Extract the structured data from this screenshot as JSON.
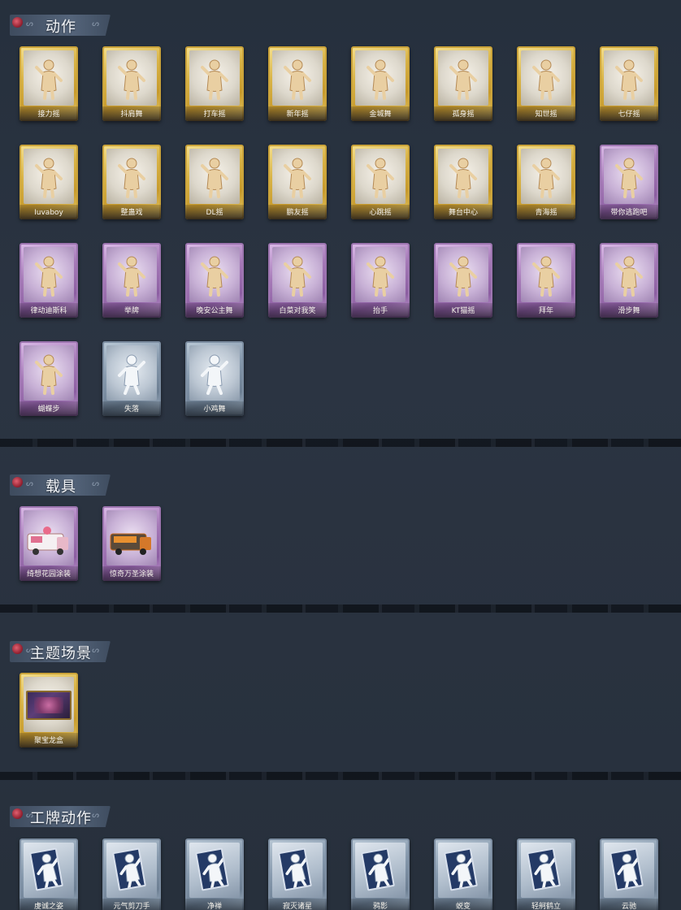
{
  "sections": {
    "actions": {
      "title": "动作",
      "items": [
        {
          "label": "接力摇",
          "tier": "gold",
          "icon": "figure-dance-icon"
        },
        {
          "label": "抖肩舞",
          "tier": "gold",
          "icon": "figure-dance-icon"
        },
        {
          "label": "打车摇",
          "tier": "gold",
          "icon": "figure-dance-icon"
        },
        {
          "label": "新年摇",
          "tier": "gold",
          "icon": "figure-dance-icon"
        },
        {
          "label": "金城舞",
          "tier": "gold",
          "icon": "figure-dance-icon"
        },
        {
          "label": "孤身摇",
          "tier": "gold",
          "icon": "figure-dance-icon"
        },
        {
          "label": "知世摇",
          "tier": "gold",
          "icon": "figure-dance-icon"
        },
        {
          "label": "七仔摇",
          "tier": "gold",
          "icon": "figure-dance-icon"
        },
        {
          "label": "Iuvaboy",
          "tier": "gold",
          "icon": "figure-dance-icon"
        },
        {
          "label": "整蛊戏",
          "tier": "gold",
          "icon": "figure-dance-icon"
        },
        {
          "label": "DL摇",
          "tier": "gold",
          "icon": "figure-dance-icon"
        },
        {
          "label": "鹏友摇",
          "tier": "gold",
          "icon": "figure-dance-icon"
        },
        {
          "label": "心跳摇",
          "tier": "gold",
          "icon": "figure-dance-icon"
        },
        {
          "label": "舞台中心",
          "tier": "gold",
          "icon": "figure-dance-icon"
        },
        {
          "label": "青海摇",
          "tier": "gold",
          "icon": "figure-dance-icon"
        },
        {
          "label": "带你逃跑吧",
          "tier": "purple",
          "icon": "figure-dance-icon"
        },
        {
          "label": "律动迪斯科",
          "tier": "purple",
          "icon": "figure-dance-icon"
        },
        {
          "label": "举牌",
          "tier": "purple",
          "icon": "figure-sign-icon"
        },
        {
          "label": "晚安公主舞",
          "tier": "purple",
          "icon": "figure-dance-icon"
        },
        {
          "label": "白菜对我笑",
          "tier": "purple",
          "icon": "figure-dance-icon"
        },
        {
          "label": "抬手",
          "tier": "purple",
          "icon": "figure-dance-icon"
        },
        {
          "label": "KT猫摇",
          "tier": "purple",
          "icon": "figure-dance-icon"
        },
        {
          "label": "拜年",
          "tier": "purple",
          "icon": "figure-dance-icon"
        },
        {
          "label": "滑步舞",
          "tier": "purple",
          "icon": "figure-dance-icon"
        },
        {
          "label": "蝴蝶步",
          "tier": "purple",
          "icon": "figure-dance-icon"
        },
        {
          "label": "失落",
          "tier": "blue",
          "icon": "figure-crawl-icon"
        },
        {
          "label": "小鸡舞",
          "tier": "blue",
          "icon": "figure-dance-icon"
        }
      ]
    },
    "vehicles": {
      "title": "载具",
      "items": [
        {
          "label": "绮想花园涂装",
          "tier": "purple",
          "icon": "ice-cream-truck-icon"
        },
        {
          "label": "惊奇万圣涂装",
          "tier": "purple",
          "icon": "halloween-truck-icon"
        }
      ]
    },
    "scenes": {
      "title": "主题场景",
      "items": [
        {
          "label": "聚宝龙盒",
          "tier": "gold",
          "icon": "scene-frame-icon"
        }
      ]
    },
    "tag_actions": {
      "title": "工牌动作",
      "items": [
        {
          "label": "虔诚之姿",
          "tier": "blue",
          "icon": "tag-card-icon"
        },
        {
          "label": "元气剪刀手",
          "tier": "blue",
          "icon": "tag-card-icon"
        },
        {
          "label": "净禅",
          "tier": "blue",
          "icon": "tag-card-icon"
        },
        {
          "label": "寂灭诸星",
          "tier": "blue",
          "icon": "tag-card-icon"
        },
        {
          "label": "鸦影",
          "tier": "blue",
          "icon": "tag-card-icon"
        },
        {
          "label": "蜕变",
          "tier": "blue",
          "icon": "tag-card-icon"
        },
        {
          "label": "轻舸鹤立",
          "tier": "blue",
          "icon": "tag-card-icon"
        },
        {
          "label": "云驰",
          "tier": "blue",
          "icon": "tag-card-icon"
        }
      ]
    }
  },
  "colors": {
    "background": "#2a3341",
    "gold": "#d9b447",
    "purple": "#a67ab8",
    "blue": "#8699ad",
    "label_text": "#f4f1ea"
  }
}
